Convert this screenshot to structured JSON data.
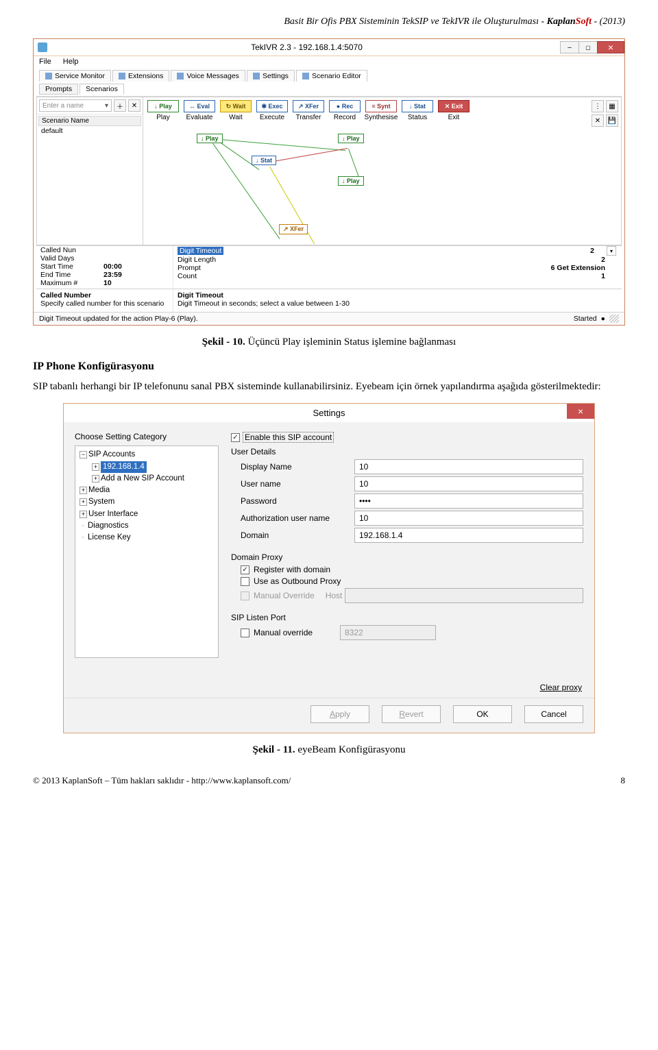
{
  "page_header": {
    "title_prefix": "Basit Bir Ofis PBX Sisteminin TekSIP ve TekIVR ile Oluşturulması - ",
    "brand_k": "Kaplan",
    "brand_s": "Soft",
    "title_suffix": " - (2013)"
  },
  "tekivr": {
    "title": "TekIVR 2.3 - 192.168.1.4:5070",
    "menu": {
      "file": "File",
      "help": "Help"
    },
    "main_tabs": {
      "service_monitor": "Service Monitor",
      "extensions": "Extensions",
      "voice_messages": "Voice Messages",
      "settings": "Settings",
      "scenario_editor": "Scenario Editor"
    },
    "sub_tabs": {
      "prompts": "Prompts",
      "scenarios": "Scenarios"
    },
    "name_placeholder": "Enter a name",
    "scenario_header": "Scenario Name",
    "scenario_item": "default",
    "tools": {
      "play": {
        "chip": "↓ Play",
        "label": "Play"
      },
      "eval": {
        "chip": "↔ Eval",
        "label": "Evaluate"
      },
      "wait": {
        "chip": "↻ Wait",
        "label": "Wait"
      },
      "exec": {
        "chip": "✱ Exec",
        "label": "Execute"
      },
      "xfer": {
        "chip": "↗ XFer",
        "label": "Transfer"
      },
      "rec": {
        "chip": "● Rec",
        "label": "Record"
      },
      "synt": {
        "chip": "≡ Synt",
        "label": "Synthesise"
      },
      "stat": {
        "chip": "↓ Stat",
        "label": "Status"
      },
      "exit": {
        "chip": "✕ Exit",
        "label": "Exit"
      }
    },
    "nodes": {
      "play1": "↓ Play",
      "play2": "↓ Play",
      "play3": "↓ Play",
      "stat": "↓ Stat",
      "xfer": "↗ XFer"
    },
    "left_props": {
      "called_num": {
        "k": "Called Nun",
        "v": ""
      },
      "valid_days": {
        "k": "Valid Days",
        "v": ""
      },
      "start_time": {
        "k": "Start Time",
        "v": "00:00"
      },
      "end_time": {
        "k": "End Time",
        "v": "23:59"
      },
      "maximum": {
        "k": "Maximum #",
        "v": "10"
      }
    },
    "right_props": {
      "digit_timeout": {
        "k": "Digit Timeout",
        "v": "2"
      },
      "digit_length": {
        "k": "Digit Length",
        "v": "2"
      },
      "prompt": {
        "k": "Prompt",
        "v": "6 Get Extension"
      },
      "count": {
        "k": "Count",
        "v": "1"
      }
    },
    "help_left": {
      "t": "Called Number",
      "d": "Specify called number for this scenario"
    },
    "help_right": {
      "t": "Digit Timeout",
      "d": "Digit Timeout in seconds; select a value between 1-30"
    },
    "status_left": "Digit Timeout updated for the action Play-6 (Play).",
    "status_right": "Started"
  },
  "fig10": {
    "label": "Şekil - 10.",
    "text": " Üçüncü Play işleminin Status işlemine bağlanması"
  },
  "section_head": "IP Phone Konfigürasyonu",
  "paragraph": "SIP tabanlı herhangi bir IP telefonunu sanal PBX sisteminde kullanabilirsiniz. Eyebeam için örnek yapılandırma aşağıda gösterilmektedir:",
  "settings": {
    "title": "Settings",
    "cat_label": "Choose Setting Category",
    "tree": {
      "sip_accounts": "SIP Accounts",
      "acct1": "192.168.1.4",
      "add_new": "Add a New SIP Account",
      "media": "Media",
      "system": "System",
      "ui": "User Interface",
      "diag": "Diagnostics",
      "license": "License Key"
    },
    "enable_label": "Enable this SIP account",
    "user_details": "User Details",
    "fields": {
      "display_name": {
        "l": "Display Name",
        "v": "10"
      },
      "user_name": {
        "l": "User name",
        "v": "10"
      },
      "password": {
        "l": "Password",
        "v": "••••"
      },
      "auth_user": {
        "l": "Authorization user name",
        "v": "10"
      },
      "domain": {
        "l": "Domain",
        "v": "192.168.1.4"
      }
    },
    "domain_proxy": "Domain Proxy",
    "register": "Register with domain",
    "outbound": "Use as Outbound Proxy",
    "manual_override": "Manual Override",
    "host_label": "Host",
    "listen_port": "SIP Listen Port",
    "manual_override2": "Manual override",
    "port_value": "8322",
    "clear_proxy": "Clear proxy",
    "actions": {
      "apply": "Apply",
      "revert": "Revert",
      "ok": "OK",
      "cancel": "Cancel"
    }
  },
  "fig11": {
    "label": "Şekil - 11.",
    "text": " eyeBeam Konfigürasyonu"
  },
  "footer": {
    "left": "© 2013 KaplanSoft – Tüm hakları saklıdır - http://www.kaplansoft.com/",
    "right": "8"
  }
}
